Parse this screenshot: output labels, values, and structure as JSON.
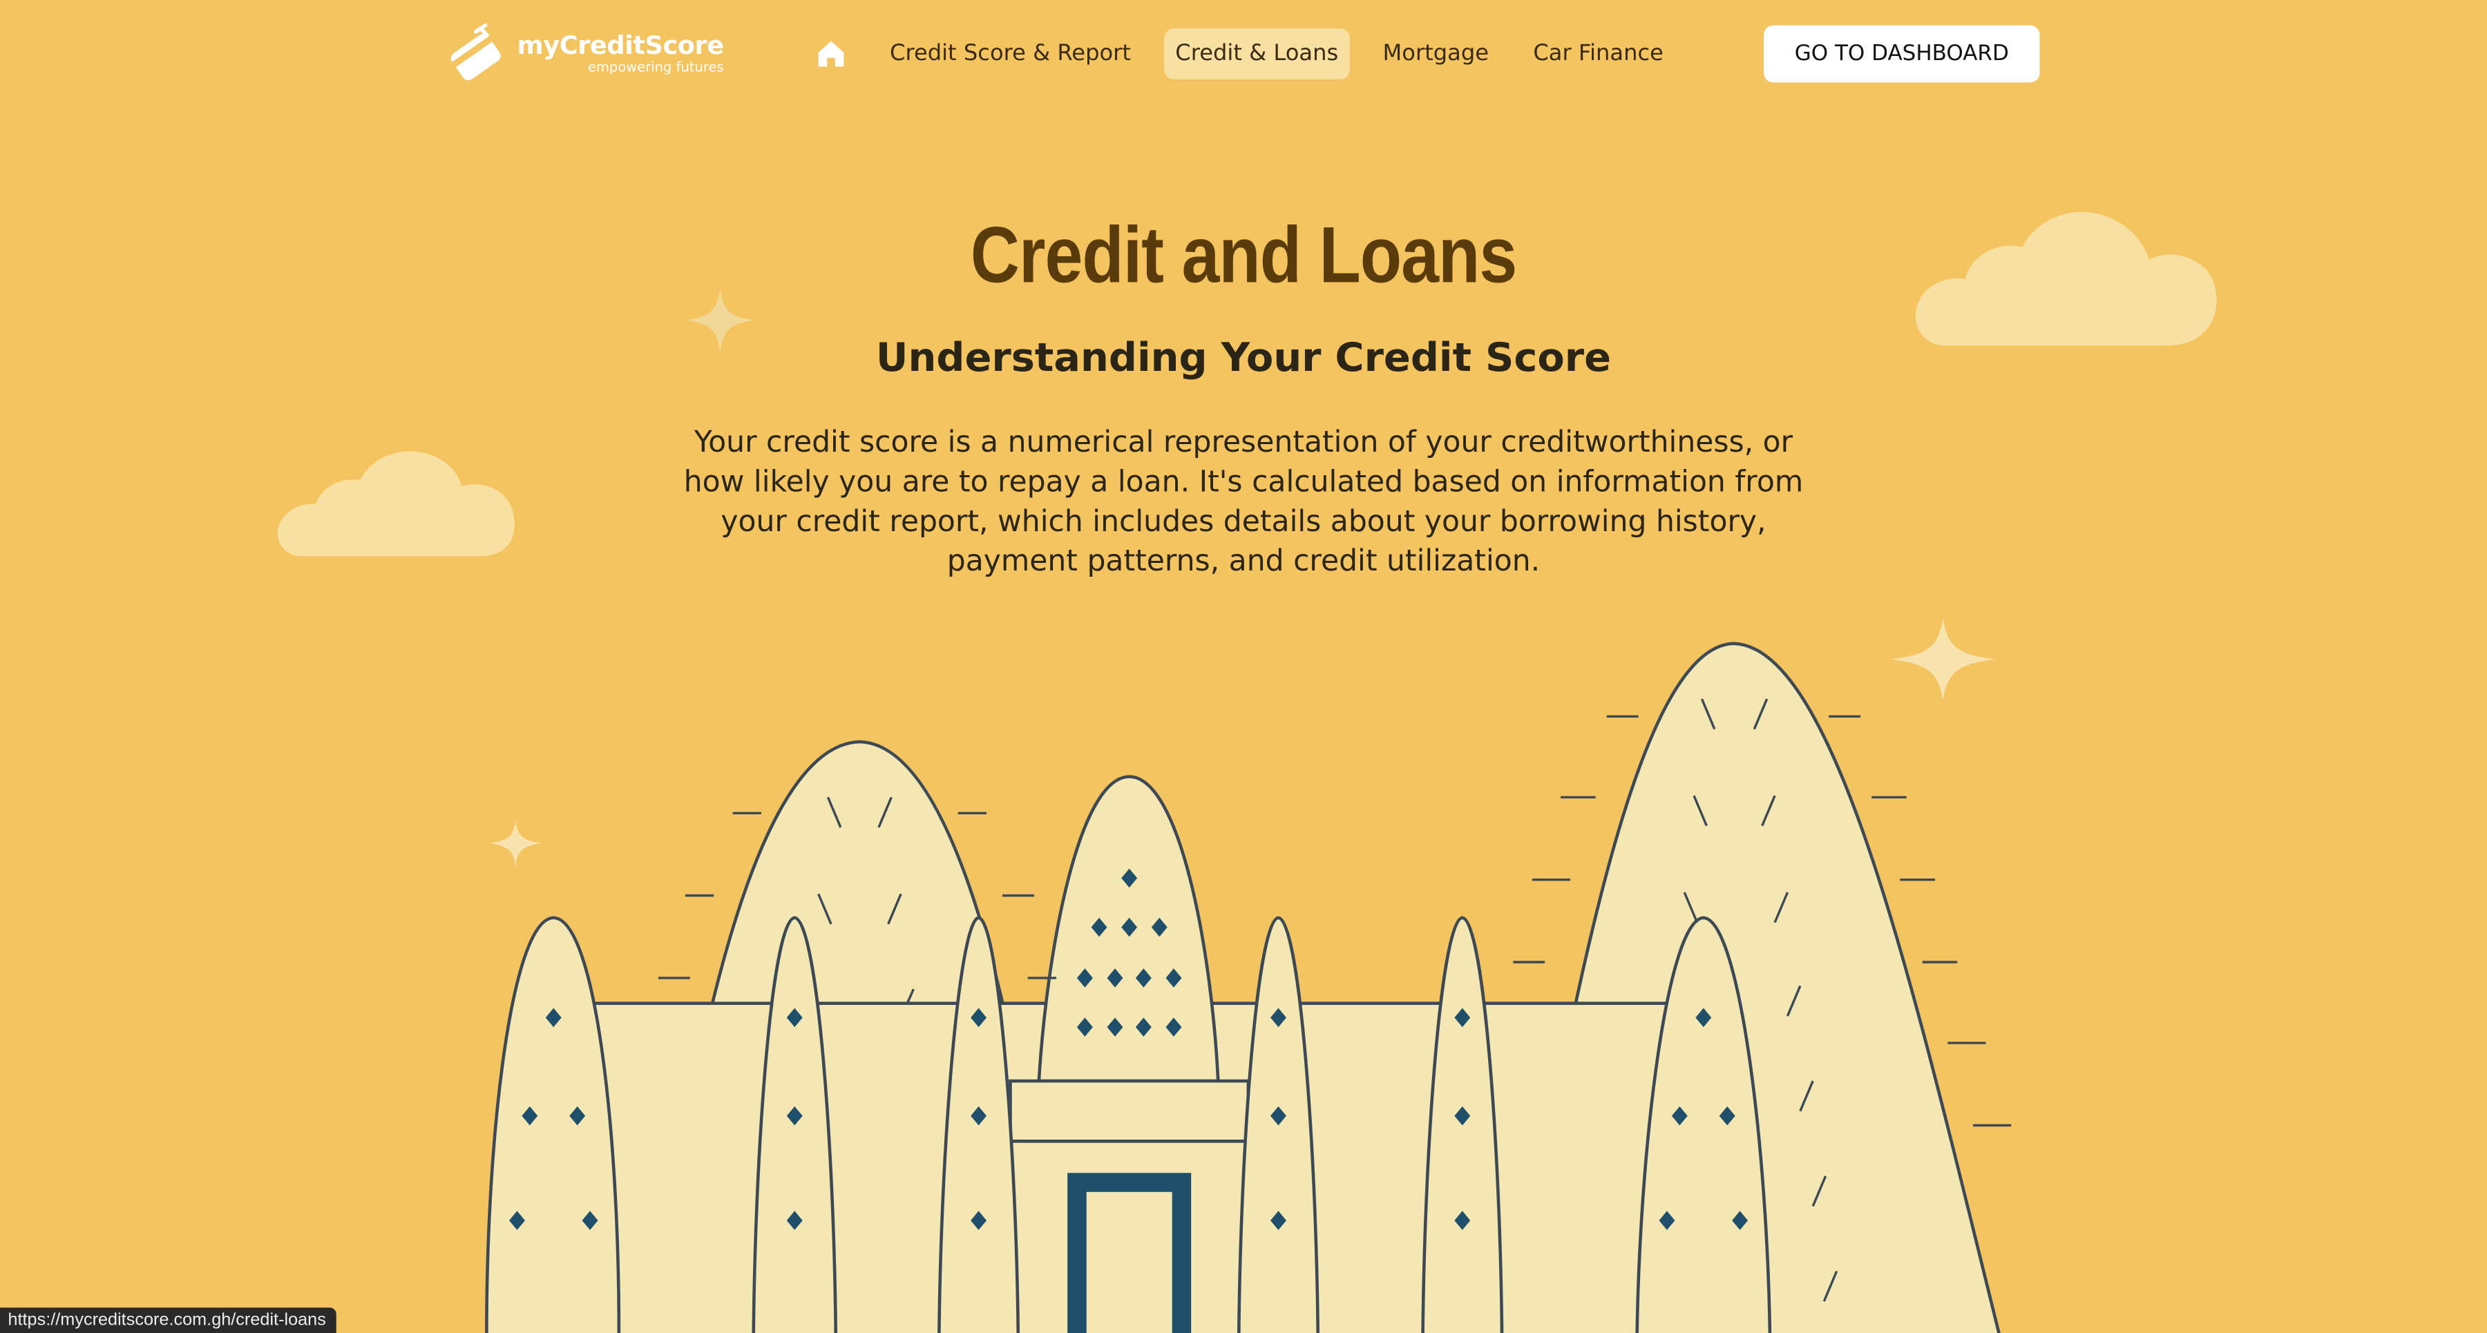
{
  "header": {
    "logo": {
      "name": "myCreditScore",
      "tagline": "empowering futures"
    },
    "nav": {
      "home_icon": "home-icon",
      "items": [
        {
          "label": "Credit Score & Report",
          "active": false
        },
        {
          "label": "Credit & Loans",
          "active": true
        },
        {
          "label": "Mortgage",
          "active": false
        },
        {
          "label": "Car Finance",
          "active": false
        }
      ]
    },
    "dashboard_button": "GO TO DASHBOARD"
  },
  "hero": {
    "title": "Credit and Loans",
    "subtitle": "Understanding Your Credit Score",
    "body": "Your credit score is a numerical representation of your creditworthiness, or how likely you are to repay a loan. It's calculated based on information from your credit report, which includes details about your borrowing history, payment patterns, and credit utilization."
  },
  "status_bar": {
    "url": "https://mycreditscore.com.gh/credit-loans"
  },
  "colors": {
    "background": "#f4c461",
    "title": "#5a3b0b",
    "building_fill": "#f5e7b3",
    "outline": "#3d4a55",
    "accent_blue": "#1f4f6b",
    "cloud": "#f8dfa2",
    "nav_active": "#f8dfa2"
  },
  "illustration": {
    "subject": "mosque-illustration",
    "decorations": [
      "cloud-icon",
      "sparkle-icon"
    ]
  }
}
